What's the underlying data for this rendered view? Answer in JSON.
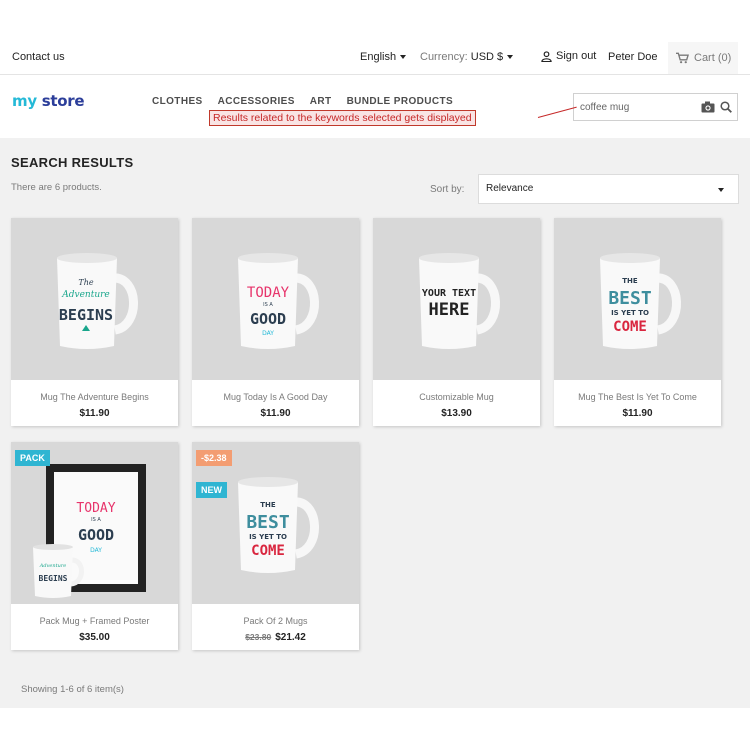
{
  "topbar": {
    "contact": "Contact us",
    "language": "English",
    "currency_label": "Currency:",
    "currency_value": "USD $",
    "sign_out": "Sign out",
    "user": "Peter Doe",
    "cart": "Cart (0)"
  },
  "header": {
    "logo_my": "my",
    "logo_store": "store",
    "nav": [
      "CLOTHES",
      "ACCESSORIES",
      "ART",
      "BUNDLE PRODUCTS"
    ],
    "search_value": "coffee mug",
    "annotation": "Results related to the keywords selected gets displayed"
  },
  "results": {
    "title": "SEARCH RESULTS",
    "count": "There are 6 products.",
    "sort_label": "Sort by:",
    "sort_value": "Relevance",
    "showing": "Showing 1-6 of 6 item(s)"
  },
  "products": [
    {
      "name": "Mug The Adventure Begins",
      "price": "$11.90"
    },
    {
      "name": "Mug Today Is A Good Day",
      "price": "$11.90"
    },
    {
      "name": "Customizable Mug",
      "price": "$13.90"
    },
    {
      "name": "Mug The Best Is Yet To Come",
      "price": "$11.90"
    },
    {
      "name": "Pack Mug + Framed Poster",
      "price": "$35.00",
      "badge": "PACK"
    },
    {
      "name": "Pack Of 2 Mugs",
      "old_price": "$23.80",
      "price": "$21.42",
      "discount": "-$2.38",
      "badge": "NEW"
    }
  ],
  "mug_art": {
    "adventure": [
      "The",
      "Adventure",
      "BEGINS"
    ],
    "today": [
      "TODAY",
      "IS A",
      "GOOD",
      "DAY"
    ],
    "custom": [
      "YOUR TEXT",
      "HERE"
    ],
    "best": [
      "THE",
      "BEST",
      "IS YET TO",
      "COME"
    ]
  },
  "colors": {
    "accent": "#2fb5d2",
    "discount": "#f39d72",
    "annotation": "#c62828"
  }
}
